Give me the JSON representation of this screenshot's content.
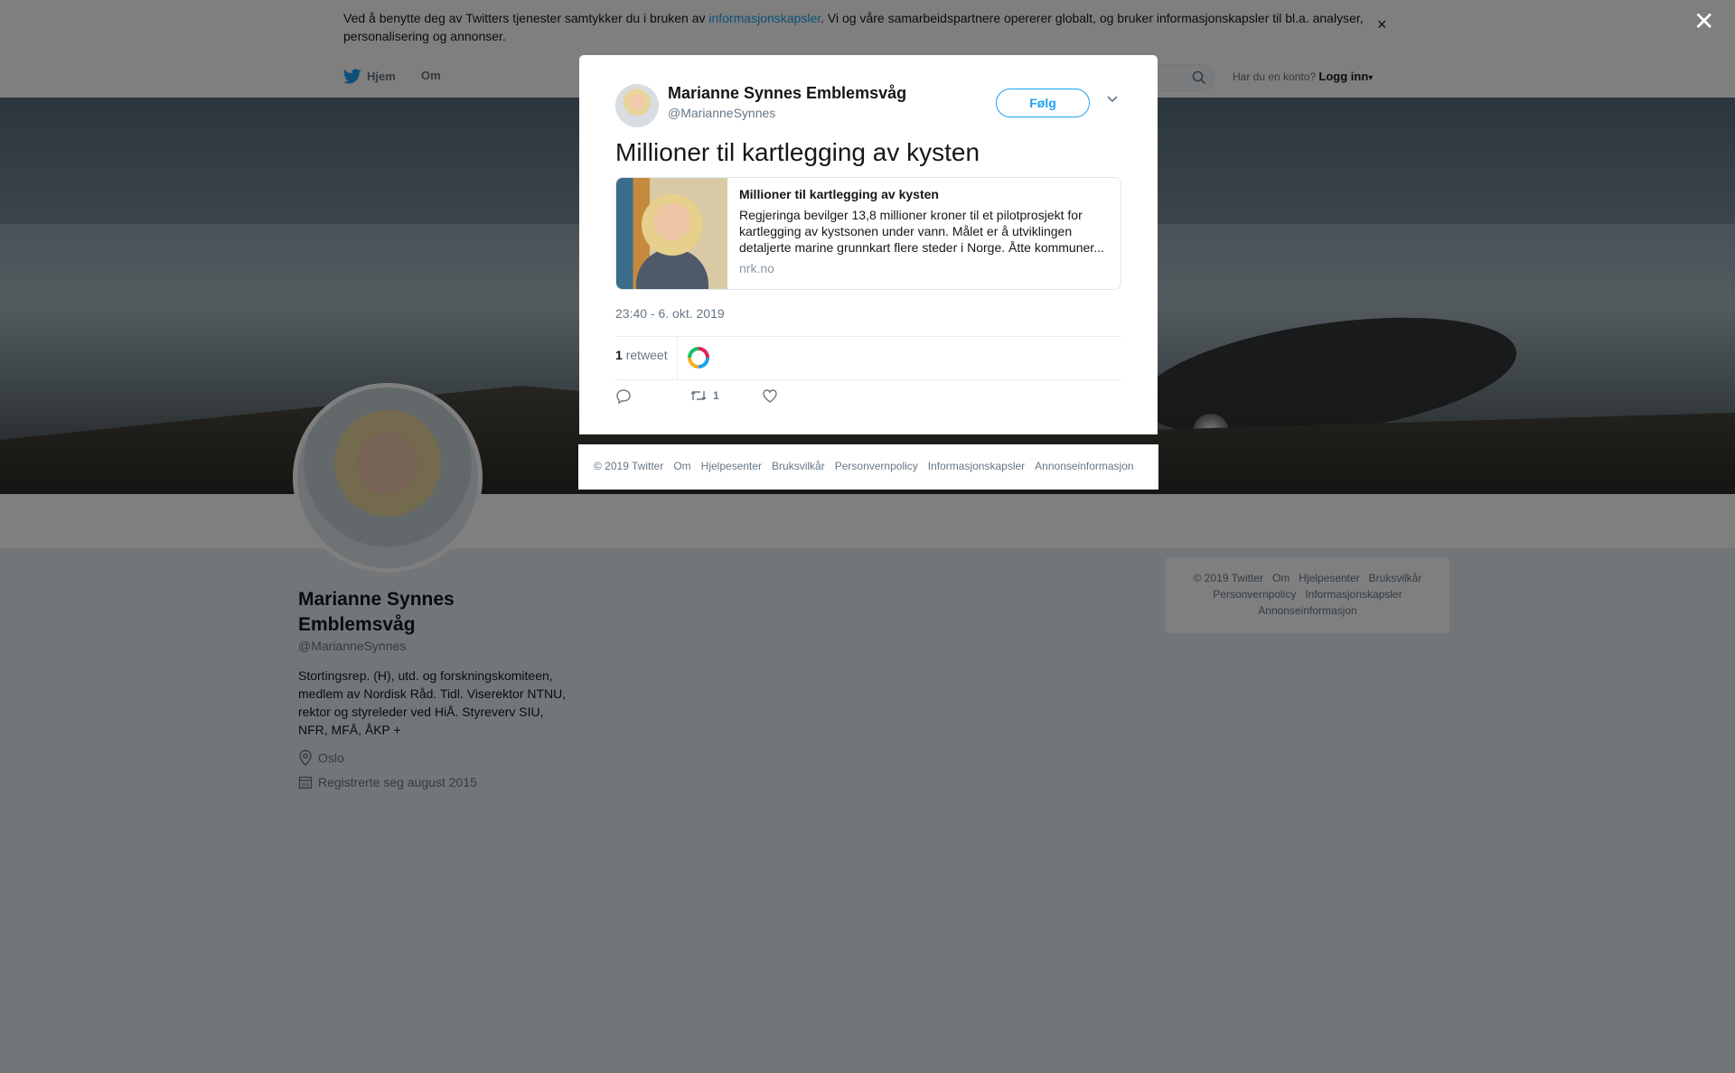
{
  "cookie": {
    "text_before": "Ved å benytte deg av Twitters tjenester samtykker du i bruken av ",
    "link": "informasjonskapsler",
    "text_after": ". Vi og våre samarbeidspartnere opererer globalt, og bruker informasjonskapsler til bl.a. analyser, personalisering og annonser.",
    "close": "×"
  },
  "nav": {
    "home": "Hjem",
    "about": "Om",
    "login_prompt": "Har du en konto?",
    "login": "Logg inn"
  },
  "profile": {
    "name": "Marianne Synnes Emblemsvåg",
    "handle": "@MarianneSynnes",
    "bio": "Stortingsrep. (H), utd. og forskningskomiteen, medlem av Nordisk Råd. Tidl. Viserektor NTNU, rektor og styreleder ved HiÅ. Styreverv SIU, NFR, MFÅ, ÅKP +",
    "location": "Oslo",
    "joined": "Registrerte seg august 2015"
  },
  "side_footer": {
    "links": [
      "© 2019 Twitter",
      "Om",
      "Hjelpesenter",
      "Bruksvilkår",
      "Personvernpolicy",
      "Informasjonskapsler",
      "Annonseinformasjon"
    ]
  },
  "overlay_close": "✕",
  "tweet": {
    "author_name": "Marianne Synnes Emblemsvåg",
    "author_handle": "@MarianneSynnes",
    "follow_label": "Følg",
    "text": "Millioner til kartlegging av kysten",
    "card": {
      "title": "Millioner til kartlegging av kysten",
      "description": "Regjeringa bevilger 13,8 millioner kroner til et pilotprosjekt for kartlegging av kystsonen under vann. Målet er å utviklingen detaljerte marine grunnkart flere steder i Norge. Åtte kommuner...",
      "domain": "nrk.no"
    },
    "timestamp": "23:40 - 6. okt. 2019",
    "retweet_count": "1",
    "retweet_word": "retweet",
    "actions": {
      "reply": "",
      "retweet": "1",
      "like": ""
    }
  },
  "modal_footer": {
    "links": [
      "© 2019 Twitter",
      "Om",
      "Hjelpesenter",
      "Bruksvilkår",
      "Personvernpolicy",
      "Informasjonskapsler",
      "Annonseinformasjon"
    ]
  },
  "colors": {
    "accent": "#1da1f2",
    "text": "#14171a",
    "muted": "#657786"
  }
}
